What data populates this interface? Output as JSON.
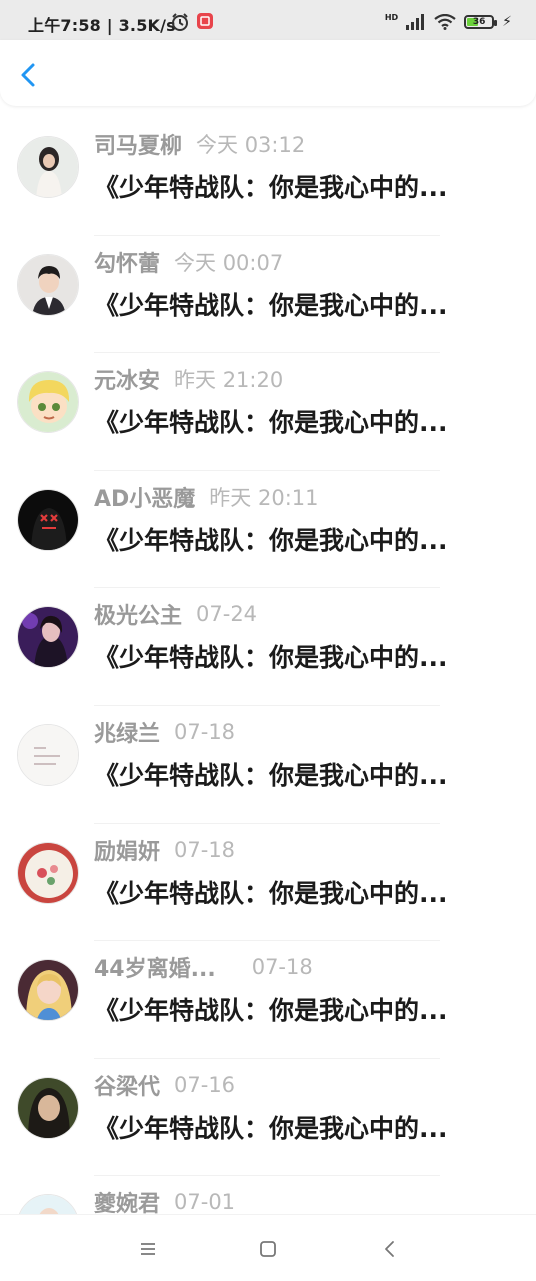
{
  "status_bar": {
    "time_speed": "上午7:58 | 3.5K/s",
    "network": "HD",
    "battery_level": "36",
    "icons": [
      "alarm-icon",
      "app-notification-icon",
      "signal-icon",
      "wifi-icon",
      "battery-icon",
      "charging-icon"
    ]
  },
  "header": {
    "back_icon": "chevron-left-icon",
    "accent_color": "#2196f3"
  },
  "conversations": [
    {
      "name": "司马夏柳",
      "time": "今天 03:12",
      "message": "《少年特战队：你是我心中的...",
      "avatar": "avatar-woman-white-dress"
    },
    {
      "name": "勾怀蕾",
      "time": "今天 00:07",
      "message": "《少年特战队：你是我心中的...",
      "avatar": "avatar-boy-suit"
    },
    {
      "name": "元冰安",
      "time": "昨天 21:20",
      "message": "《少年特战队：你是我心中的...",
      "avatar": "avatar-cartoon-boy"
    },
    {
      "name": "AD小恶魔",
      "time": "昨天 20:11",
      "message": "《少年特战队：你是我心中的...",
      "avatar": "avatar-dark-mask"
    },
    {
      "name": "极光公主",
      "time": "07-24",
      "message": "《少年特战队：你是我心中的...",
      "avatar": "avatar-purple-woman"
    },
    {
      "name": "兆绿兰",
      "time": "07-18",
      "message": "《少年特战队：你是我心中的...",
      "avatar": "avatar-text-card"
    },
    {
      "name": "励娟妍",
      "time": "07-18",
      "message": "《少年特战队：你是我心中的...",
      "avatar": "avatar-flower-plate"
    },
    {
      "name": "44岁离婚...",
      "time": "07-18",
      "message": "《少年特战队：你是我心中的...",
      "avatar": "avatar-blonde-girl"
    },
    {
      "name": "谷梁代",
      "time": "07-16",
      "message": "《少年特战队：你是我心中的...",
      "avatar": "avatar-woman-dark"
    },
    {
      "name": "夔婉君",
      "time": "07-01",
      "message": "",
      "avatar": "avatar-partial"
    }
  ],
  "nav_bar": {
    "icons": [
      "menu-icon",
      "home-square-icon",
      "back-triangle-icon"
    ]
  }
}
